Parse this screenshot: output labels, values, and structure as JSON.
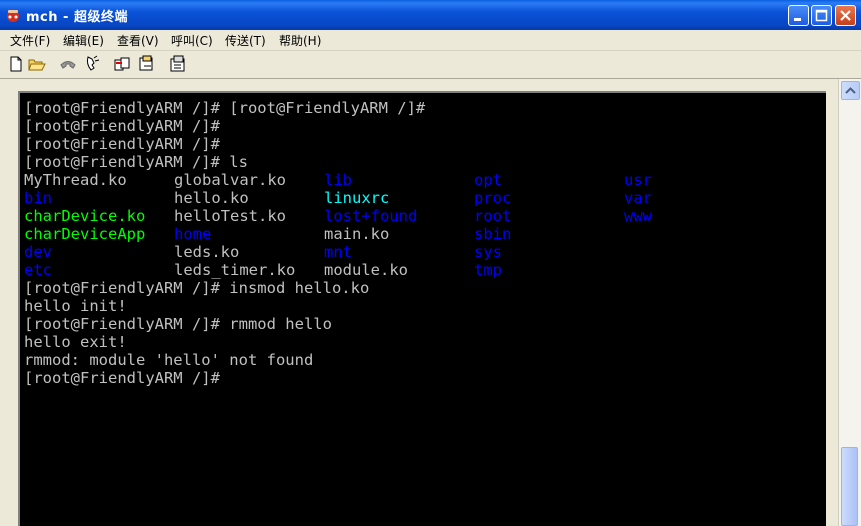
{
  "window": {
    "title": "mch - 超级终端"
  },
  "menu": [
    "文件(F)",
    "编辑(E)",
    "查看(V)",
    "呼叫(C)",
    "传送(T)",
    "帮助(H)"
  ],
  "toolbar": [
    "new-file-icon",
    "open-folder-icon",
    "connect-phone-icon",
    "disconnect-phone-icon",
    "send-icon",
    "receive-icon",
    "properties-icon"
  ],
  "colors": {
    "plain": "#c0c0c0",
    "dir": "#0000ff",
    "exec": "#00ff00",
    "link": "#00ffff"
  },
  "terminal": {
    "lines_top": [
      "[root@FriendlyARM /]# [root@FriendlyARM /]#",
      "[root@FriendlyARM /]#",
      "[root@FriendlyARM /]#",
      "[root@FriendlyARM /]# ls"
    ],
    "ls": [
      [
        {
          "t": "MyThread.ko",
          "c": "plain"
        },
        {
          "t": "globalvar.ko",
          "c": "plain"
        },
        {
          "t": "lib",
          "c": "dir"
        },
        {
          "t": "opt",
          "c": "dir"
        },
        {
          "t": "usr",
          "c": "dir"
        }
      ],
      [
        {
          "t": "bin",
          "c": "dir"
        },
        {
          "t": "hello.ko",
          "c": "plain"
        },
        {
          "t": "linuxrc",
          "c": "link"
        },
        {
          "t": "proc",
          "c": "dir"
        },
        {
          "t": "var",
          "c": "dir"
        }
      ],
      [
        {
          "t": "charDevice.ko",
          "c": "exec"
        },
        {
          "t": "helloTest.ko",
          "c": "plain"
        },
        {
          "t": "lost+found",
          "c": "dir"
        },
        {
          "t": "root",
          "c": "dir"
        },
        {
          "t": "www",
          "c": "dir"
        }
      ],
      [
        {
          "t": "charDeviceApp",
          "c": "exec"
        },
        {
          "t": "home",
          "c": "dir"
        },
        {
          "t": "main.ko",
          "c": "plain"
        },
        {
          "t": "sbin",
          "c": "dir"
        },
        {
          "t": "",
          "c": "plain"
        }
      ],
      [
        {
          "t": "dev",
          "c": "dir"
        },
        {
          "t": "leds.ko",
          "c": "plain"
        },
        {
          "t": "mnt",
          "c": "dir"
        },
        {
          "t": "sys",
          "c": "dir"
        },
        {
          "t": "",
          "c": "plain"
        }
      ],
      [
        {
          "t": "etc",
          "c": "dir"
        },
        {
          "t": "leds_timer.ko",
          "c": "plain"
        },
        {
          "t": "module.ko",
          "c": "plain"
        },
        {
          "t": "tmp",
          "c": "dir"
        },
        {
          "t": "",
          "c": "plain"
        }
      ]
    ],
    "lines_bottom": [
      "[root@FriendlyARM /]# insmod hello.ko",
      "hello init!",
      "[root@FriendlyARM /]# rmmod hello",
      "hello exit!",
      "rmmod: module 'hello' not found",
      "[root@FriendlyARM /]#"
    ]
  }
}
